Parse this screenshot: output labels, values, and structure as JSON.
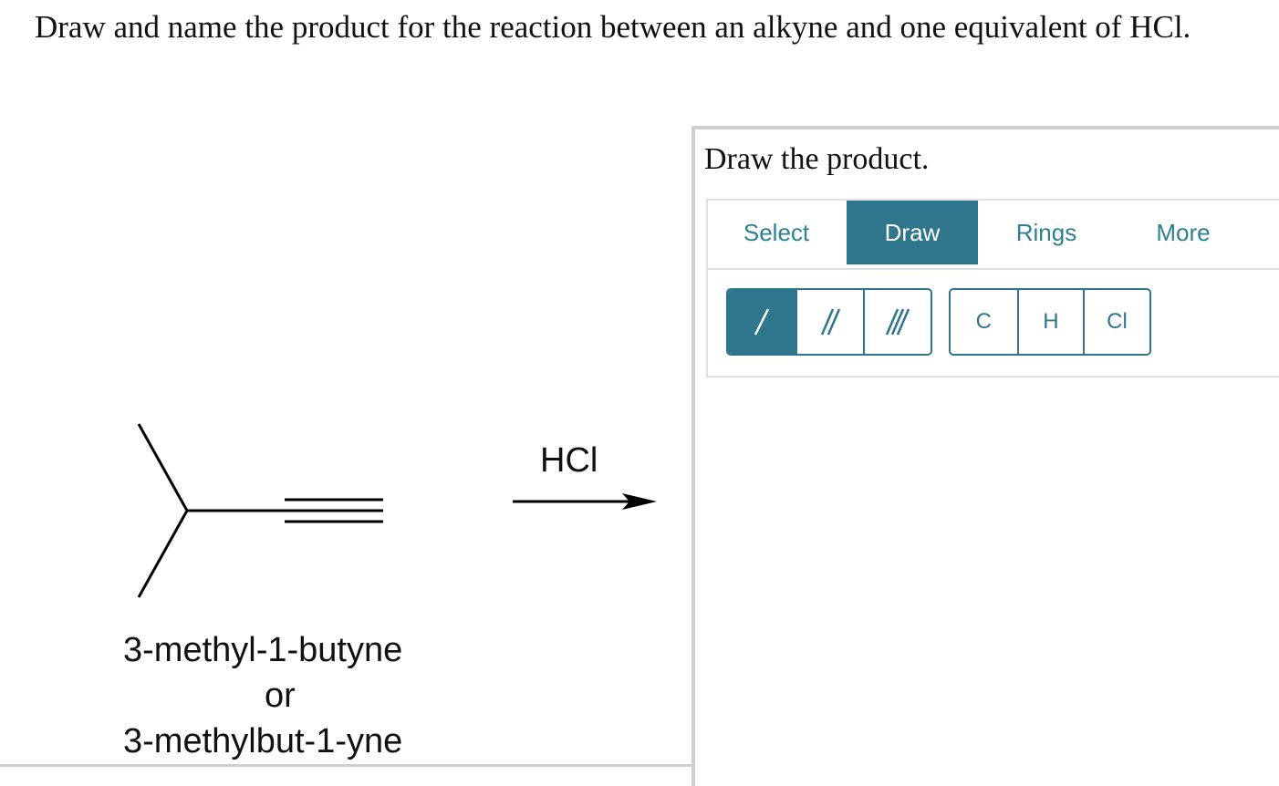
{
  "question": {
    "text": "Draw and name the product for the reaction between an alkyne and one equivalent of HCl."
  },
  "reaction": {
    "reagent": "HCl",
    "reactant_name_1": "3-methyl-1-butyne",
    "reactant_name_or": "or",
    "reactant_name_2": "3-methylbut-1-yne"
  },
  "panel": {
    "title": "Draw the product.",
    "tabs": [
      {
        "label": "Select"
      },
      {
        "label": "Draw",
        "active": true
      },
      {
        "label": "Rings"
      },
      {
        "label": "More"
      }
    ],
    "bond_tools": [
      {
        "icon": "single-bond-icon"
      },
      {
        "icon": "double-bond-icon"
      },
      {
        "icon": "triple-bond-icon"
      }
    ],
    "atom_tools": [
      {
        "label": "C"
      },
      {
        "label": "H"
      },
      {
        "label": "Cl"
      }
    ]
  },
  "colors": {
    "accent": "#2f758b",
    "accent_text": "#2e7f93",
    "border": "#cfcfcf"
  }
}
